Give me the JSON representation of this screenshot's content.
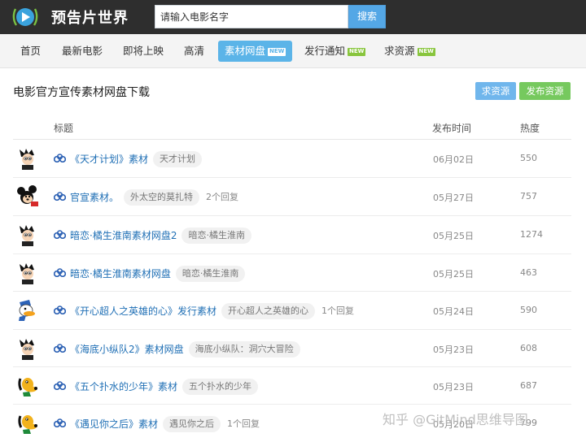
{
  "header": {
    "logo_text": "预告片世界",
    "search_placeholder": "请输入电影名字",
    "search_button": "搜索"
  },
  "nav": {
    "items": [
      {
        "label": "首页",
        "active": false,
        "badge": ""
      },
      {
        "label": "最新电影",
        "active": false,
        "badge": ""
      },
      {
        "label": "即将上映",
        "active": false,
        "badge": ""
      },
      {
        "label": "高清",
        "active": false,
        "badge": ""
      },
      {
        "label": "素材网盘",
        "active": true,
        "badge": "NEW"
      },
      {
        "label": "发行通知",
        "active": false,
        "badge": "NEW"
      },
      {
        "label": "求资源",
        "active": false,
        "badge": "NEW"
      }
    ]
  },
  "section": {
    "title": "电影官方宣传素材网盘下载",
    "request_button": "求资源",
    "publish_button": "发布资源"
  },
  "table": {
    "columns": [
      "标题",
      "发布时间",
      "热度"
    ],
    "rows": [
      {
        "avatar": "astro-boy",
        "title": "《天才计划》素材",
        "tag": "天才计划",
        "replies": "",
        "date": "06月02日",
        "heat": "550"
      },
      {
        "avatar": "mickey",
        "title": "官宣素材。",
        "tag": "外太空的莫扎特",
        "replies": "2个回复",
        "date": "05月27日",
        "heat": "757"
      },
      {
        "avatar": "astro-boy",
        "title": "暗恋·橘生淮南素材网盘2",
        "tag": "暗恋·橘生淮南",
        "replies": "",
        "date": "05月25日",
        "heat": "1274"
      },
      {
        "avatar": "astro-boy",
        "title": "暗恋·橘生淮南素材网盘",
        "tag": "暗恋·橘生淮南",
        "replies": "",
        "date": "05月25日",
        "heat": "463"
      },
      {
        "avatar": "donald",
        "title": "《开心超人之英雄的心》发行素材",
        "tag": "开心超人之英雄的心",
        "replies": "1个回复",
        "date": "05月24日",
        "heat": "590"
      },
      {
        "avatar": "astro-boy",
        "title": "《海底小纵队2》素材网盘",
        "tag": "海底小纵队：洞穴大冒险",
        "replies": "",
        "date": "05月23日",
        "heat": "608"
      },
      {
        "avatar": "pluto",
        "title": "《五个扑水的少年》素材",
        "tag": "五个扑水的少年",
        "replies": "",
        "date": "05月23日",
        "heat": "687"
      },
      {
        "avatar": "pluto",
        "title": "《遇见你之后》素材",
        "tag": "遇见你之后",
        "replies": "1个回复",
        "date": "05月20日",
        "heat": "799"
      }
    ]
  },
  "watermark": "知乎 @GitMind思维导图",
  "colors": {
    "topbar": "#2e2e2e",
    "accent_blue": "#5bb4e8",
    "publish_green": "#76c95e",
    "link_blue": "#1f6fb5",
    "badge_green": "#88c53d"
  }
}
